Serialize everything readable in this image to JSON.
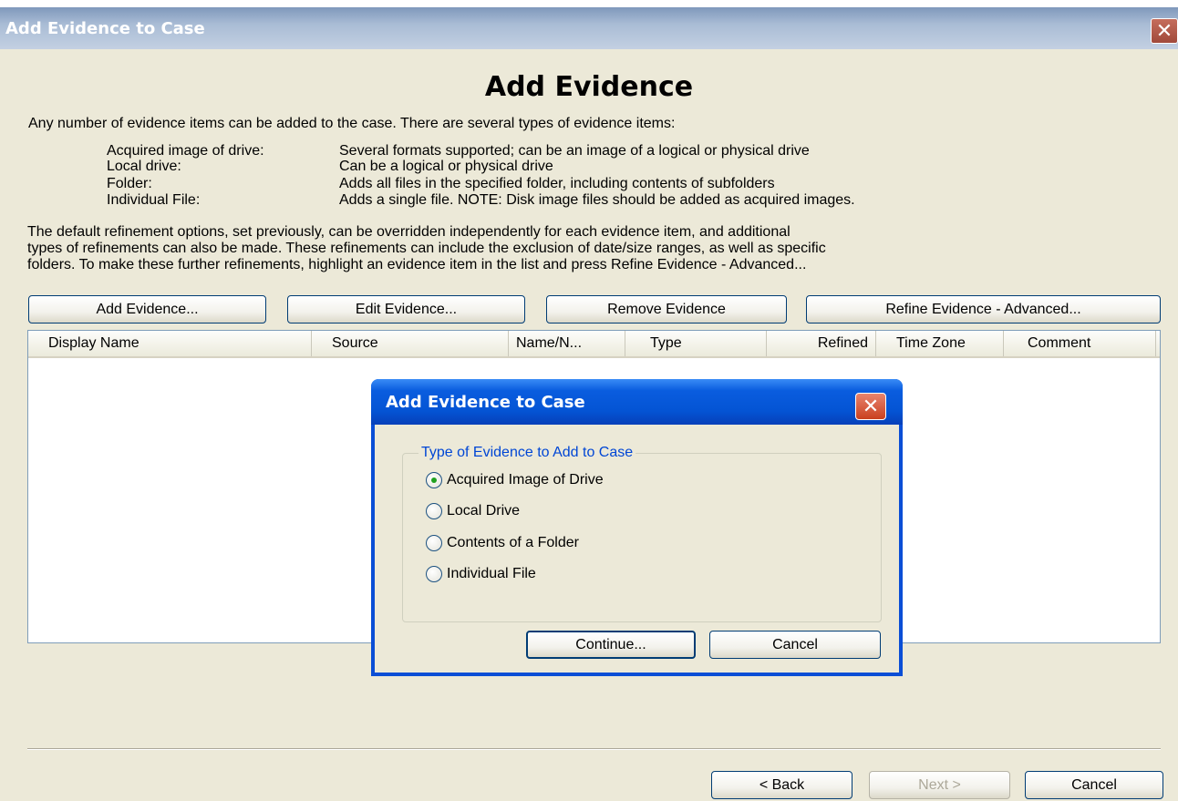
{
  "window": {
    "title": "Add Evidence to Case",
    "close_glyph": "✕"
  },
  "page": {
    "heading": "Add Evidence",
    "intro": "Any number of evidence items can be added to the case. There are several types of evidence items:",
    "types": [
      {
        "label": "Acquired image of drive:",
        "desc": "Several formats supported; can be an image of a logical or physical drive"
      },
      {
        "label": "Local drive:",
        "desc": "Can be a logical or physical drive"
      },
      {
        "label": "Folder:",
        "desc": "Adds all files in the specified folder, including contents of subfolders"
      },
      {
        "label": "Individual File:",
        "desc": "Adds a single file.  NOTE: Disk image files should be added as acquired images."
      }
    ],
    "paragraph": [
      "The default refinement options, set previously, can be overridden independently for each evidence item, and additional",
      "types of refinements can also be made. These refinements can include the exclusion of date/size ranges, as well as specific",
      "folders. To make these further refinements, highlight an evidence item in the list and press Refine Evidence - Advanced..."
    ]
  },
  "toolbar": {
    "add": "Add Evidence...",
    "edit": "Edit Evidence...",
    "remove": "Remove Evidence",
    "refine": "Refine Evidence - Advanced..."
  },
  "list": {
    "columns": [
      "Display Name",
      "Source",
      "Name/N...",
      "Type",
      "Refined",
      "Time Zone",
      "Comment"
    ],
    "rows": []
  },
  "footer": {
    "back": "< Back",
    "next": "Next >",
    "cancel": "Cancel"
  },
  "dialog": {
    "title": "Add Evidence to Case",
    "close_glyph": "✕",
    "group_label": "Type of Evidence to Add to Case",
    "options": [
      "Acquired Image of Drive",
      "Local Drive",
      "Contents of a Folder",
      "Individual File"
    ],
    "selected_option": "Acquired Image of Drive",
    "continue": "Continue...",
    "cancel": "Cancel"
  },
  "colors": {
    "window_bg": "#ece9d8",
    "dialog_titlebar": "#0454d4",
    "group_label": "#0046d5",
    "close_button": "#c9401f"
  }
}
